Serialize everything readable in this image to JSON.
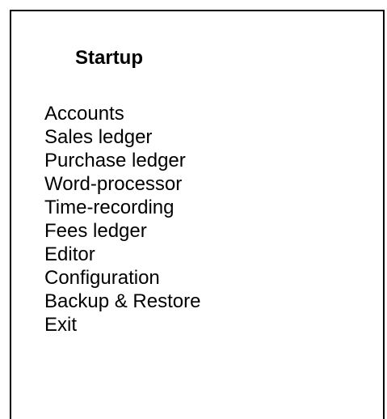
{
  "menu": {
    "title": "Startup",
    "items": [
      {
        "label": "Accounts"
      },
      {
        "label": "Sales ledger"
      },
      {
        "label": "Purchase ledger"
      },
      {
        "label": "Word-processor"
      },
      {
        "label": "Time-recording"
      },
      {
        "label": "Fees ledger"
      },
      {
        "label": "Editor"
      },
      {
        "label": "Configuration"
      },
      {
        "label": "Backup & Restore"
      },
      {
        "label": "Exit"
      }
    ]
  }
}
